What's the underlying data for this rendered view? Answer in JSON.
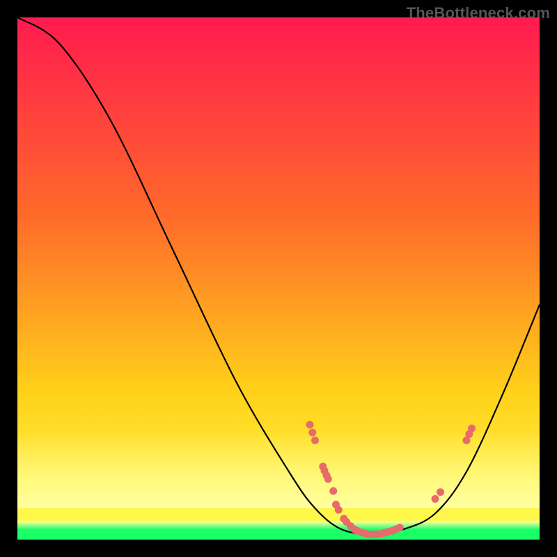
{
  "attribution": "TheBottleneck.com",
  "colors": {
    "background": "#000000",
    "gradient_top": "#ff1a4f",
    "gradient_mid1": "#ff6a2a",
    "gradient_mid2": "#ffd21a",
    "gradient_bot": "#ffff55",
    "optimal_band": "#1aff66",
    "light_yellow": "#ffffa0",
    "curve": "#000000",
    "dot": "#e86b6b"
  },
  "chart_data": {
    "type": "line",
    "xlabel": "",
    "ylabel": "",
    "xlim": [
      0,
      100
    ],
    "ylim": [
      0,
      100
    ],
    "curve": [
      {
        "x": 0,
        "y": 100
      },
      {
        "x": 8,
        "y": 95
      },
      {
        "x": 18,
        "y": 80
      },
      {
        "x": 30,
        "y": 55
      },
      {
        "x": 42,
        "y": 30
      },
      {
        "x": 52,
        "y": 13
      },
      {
        "x": 57,
        "y": 6
      },
      {
        "x": 62,
        "y": 2
      },
      {
        "x": 68,
        "y": 1
      },
      {
        "x": 74,
        "y": 2
      },
      {
        "x": 80,
        "y": 5
      },
      {
        "x": 86,
        "y": 13
      },
      {
        "x": 93,
        "y": 28
      },
      {
        "x": 100,
        "y": 45
      }
    ],
    "markers": [
      {
        "x": 56,
        "y": 22
      },
      {
        "x": 56.5,
        "y": 20.5
      },
      {
        "x": 57,
        "y": 19
      },
      {
        "x": 58.5,
        "y": 14
      },
      {
        "x": 58.8,
        "y": 13.2
      },
      {
        "x": 59.2,
        "y": 12.3
      },
      {
        "x": 59.5,
        "y": 11.6
      },
      {
        "x": 60.5,
        "y": 9.3
      },
      {
        "x": 61,
        "y": 6.7
      },
      {
        "x": 61.5,
        "y": 5.7
      },
      {
        "x": 62.5,
        "y": 4
      },
      {
        "x": 63,
        "y": 3.4
      },
      {
        "x": 63.8,
        "y": 2.6
      },
      {
        "x": 64.5,
        "y": 2
      },
      {
        "x": 65,
        "y": 1.7
      },
      {
        "x": 65.8,
        "y": 1.4
      },
      {
        "x": 66.5,
        "y": 1.2
      },
      {
        "x": 67.2,
        "y": 1
      },
      {
        "x": 68,
        "y": 1
      },
      {
        "x": 68.8,
        "y": 1
      },
      {
        "x": 69.5,
        "y": 1.1
      },
      {
        "x": 70.3,
        "y": 1.3
      },
      {
        "x": 71,
        "y": 1.5
      },
      {
        "x": 71.8,
        "y": 1.7
      },
      {
        "x": 72.5,
        "y": 2
      },
      {
        "x": 73.2,
        "y": 2.3
      },
      {
        "x": 80,
        "y": 7.8
      },
      {
        "x": 81,
        "y": 9.1
      },
      {
        "x": 86,
        "y": 19
      },
      {
        "x": 86.5,
        "y": 20.2
      },
      {
        "x": 87,
        "y": 21.3
      }
    ],
    "light_yellow_band_top_pct": 21,
    "optimal_band_bottom_pct": 2
  }
}
